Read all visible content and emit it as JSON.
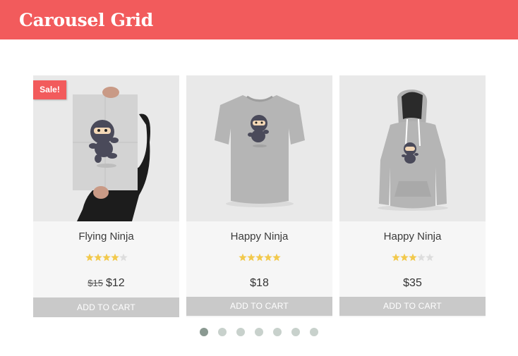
{
  "header": {
    "title": "Carousel Grid"
  },
  "products": [
    {
      "name": "Flying Ninja",
      "badge": "Sale!",
      "rating_stars": 4,
      "rating_max": 5,
      "price_old": "$15",
      "price": "$12",
      "cart_label": "ADD TO CART",
      "image_icon": "ninja-poster-icon"
    },
    {
      "name": "Happy Ninja",
      "rating_stars": 5,
      "rating_max": 5,
      "price": "$18",
      "cart_label": "ADD TO CART",
      "image_icon": "ninja-tshirt-icon"
    },
    {
      "name": "Happy Ninja",
      "rating_stars": 3,
      "rating_max": 5,
      "price": "$35",
      "cart_label": "ADD TO CART",
      "image_icon": "ninja-hoodie-icon"
    }
  ],
  "pagination": {
    "total_pages": 7,
    "current_page": 1
  },
  "colors": {
    "accent": "#f25b5c",
    "star_filled": "#f2c94c",
    "star_empty": "#dddddd",
    "button": "#c9c9c9",
    "dot": "#c8d1cc",
    "dot_active": "#8a9991"
  }
}
